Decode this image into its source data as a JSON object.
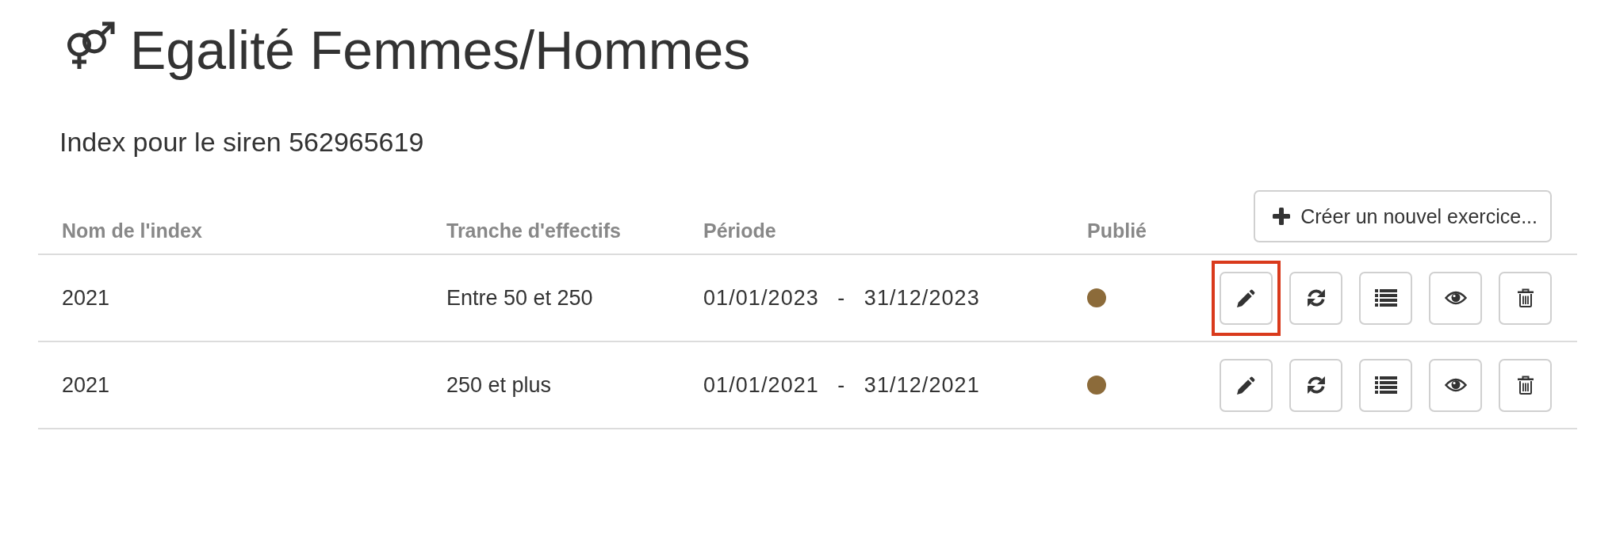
{
  "header": {
    "title": "Egalité Femmes/Hommes",
    "subtitle": "Index pour le siren 562965619"
  },
  "table": {
    "columns": [
      "Nom de l'index",
      "Tranche d'effectifs",
      "Période",
      "Publié"
    ],
    "create_button": {
      "label": "Créer un nouvel exercice..."
    },
    "rows": [
      {
        "name": "2021",
        "workforce": "Entre 50 et 250",
        "period": "01/01/2023 - 31/12/2023",
        "published": true,
        "actions": [
          {
            "kind": "edit",
            "highlighted": true
          },
          {
            "kind": "refresh",
            "highlighted": false
          },
          {
            "kind": "list",
            "highlighted": false
          },
          {
            "kind": "view",
            "highlighted": false
          },
          {
            "kind": "delete",
            "highlighted": false
          }
        ]
      },
      {
        "name": "2021",
        "workforce": "250 et plus",
        "period": "01/01/2021 - 31/12/2021",
        "published": true,
        "actions": [
          {
            "kind": "edit",
            "highlighted": false
          },
          {
            "kind": "refresh",
            "highlighted": false
          },
          {
            "kind": "list",
            "highlighted": false
          },
          {
            "kind": "view",
            "highlighted": false
          },
          {
            "kind": "delete",
            "highlighted": false
          }
        ]
      }
    ]
  }
}
